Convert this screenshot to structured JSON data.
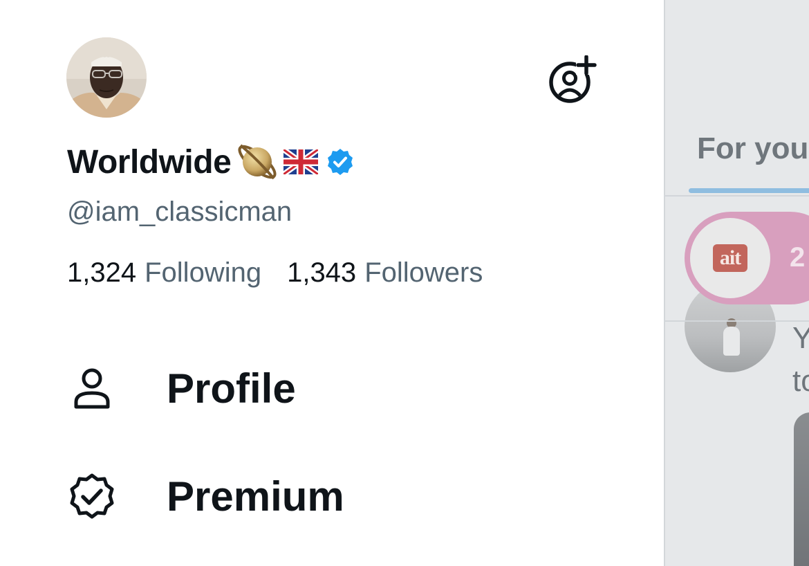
{
  "account": {
    "display_name": "Worldwide",
    "name_emojis": [
      "saturn-emoji",
      "uk-flag-emoji"
    ],
    "verified": true,
    "handle": "@iam_classicman",
    "following_count": "1,324",
    "following_label": "Following",
    "followers_count": "1,343",
    "followers_label": "Followers"
  },
  "nav": {
    "items": [
      {
        "label": "Profile",
        "icon": "person-icon"
      },
      {
        "label": "Premium",
        "icon": "premium-badge-icon"
      }
    ]
  },
  "header": {
    "add_account_icon": "add-account-icon"
  },
  "timeline": {
    "tab_label": "For you",
    "space_logo_text": "ait",
    "space_count_partial": "2",
    "post_text_partial": "Y\nto"
  },
  "colors": {
    "accent": "#1d9bf0",
    "verified": "#1d9bf0",
    "text_primary": "#0f1419",
    "text_secondary": "#536471",
    "overlay_bg": "#e6e8ea",
    "space_pill": "#d89fbe"
  }
}
